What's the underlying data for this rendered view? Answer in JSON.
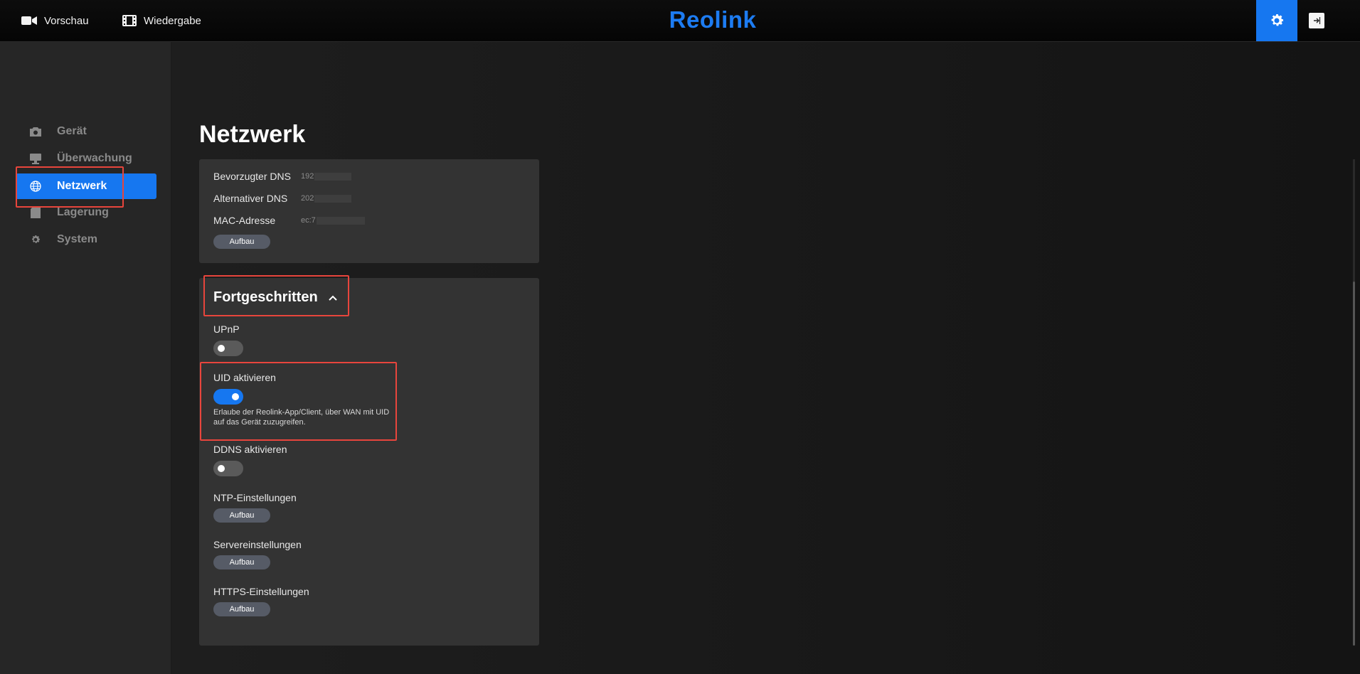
{
  "topbar": {
    "preview_label": "Vorschau",
    "playback_label": "Wiedergabe",
    "logo_text": "Reolink",
    "accent_color": "#1677f0"
  },
  "sidebar": {
    "items": [
      {
        "label": "Gerät",
        "icon": "camera-icon"
      },
      {
        "label": "Überwachung",
        "icon": "monitor-icon"
      },
      {
        "label": "Netzwerk",
        "icon": "globe-icon",
        "active": true
      },
      {
        "label": "Lagerung",
        "icon": "storage-icon"
      },
      {
        "label": "System",
        "icon": "gear-icon"
      }
    ]
  },
  "page": {
    "title": "Netzwerk"
  },
  "network_card": {
    "dns_preferred_label": "Bevorzugter DNS",
    "dns_preferred_value": "192",
    "dns_alt_label": "Alternativer DNS",
    "dns_alt_value": "202",
    "mac_label": "MAC-Adresse",
    "mac_value": "ec:7",
    "setup_label": "Aufbau"
  },
  "advanced": {
    "title": "Fortgeschritten",
    "upnp_label": "UPnP",
    "upnp_on": false,
    "uid_label": "UID aktivieren",
    "uid_on": true,
    "uid_help": "Erlaube der Reolink-App/Client, über WAN mit UID auf das Gerät zuzugreifen.",
    "ddns_label": "DDNS aktivieren",
    "ddns_on": false,
    "ntp_label": "NTP-Einstellungen",
    "server_label": "Servereinstellungen",
    "https_label": "HTTPS-Einstellungen",
    "setup_label": "Aufbau"
  },
  "highlight_color": "#e8453c"
}
